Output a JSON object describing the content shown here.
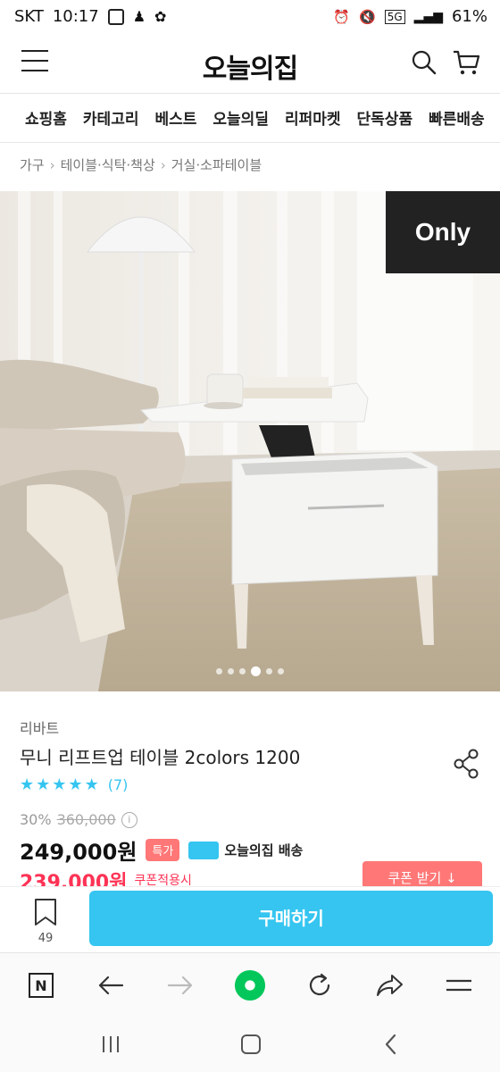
{
  "status": {
    "carrier": "SKT",
    "time": "10:17",
    "battery": "61%",
    "network": "5G"
  },
  "app": {
    "logo": "오늘의집"
  },
  "tabs": [
    "쇼핑홈",
    "카테고리",
    "베스트",
    "오늘의딜",
    "리퍼마켓",
    "단독상품",
    "빠른배송"
  ],
  "breadcrumb": [
    "가구",
    "테이블·식탁·책상",
    "거실·소파테이블"
  ],
  "hero": {
    "badge": "Only",
    "total_images": 6,
    "active_index": 3
  },
  "product": {
    "brand": "리바트",
    "name": "무니 리프트업 테이블 2colors 1200",
    "rating_stars": 5,
    "review_count": "(7)",
    "discount_pct": "30%",
    "original_price": "360,000",
    "price": "249,000원",
    "special_badge": "특가",
    "shipping_label": "오늘의집 배송",
    "coupon_price": "239,000원",
    "coupon_note": "쿠폰적용시",
    "coupon_button": "쿠폰 받기 ↓"
  },
  "bottom": {
    "bookmark_count": "49",
    "buy_label": "구매하기"
  },
  "colors": {
    "accent": "#35c5f0",
    "sale": "#ff3355",
    "badge": "#222222"
  }
}
